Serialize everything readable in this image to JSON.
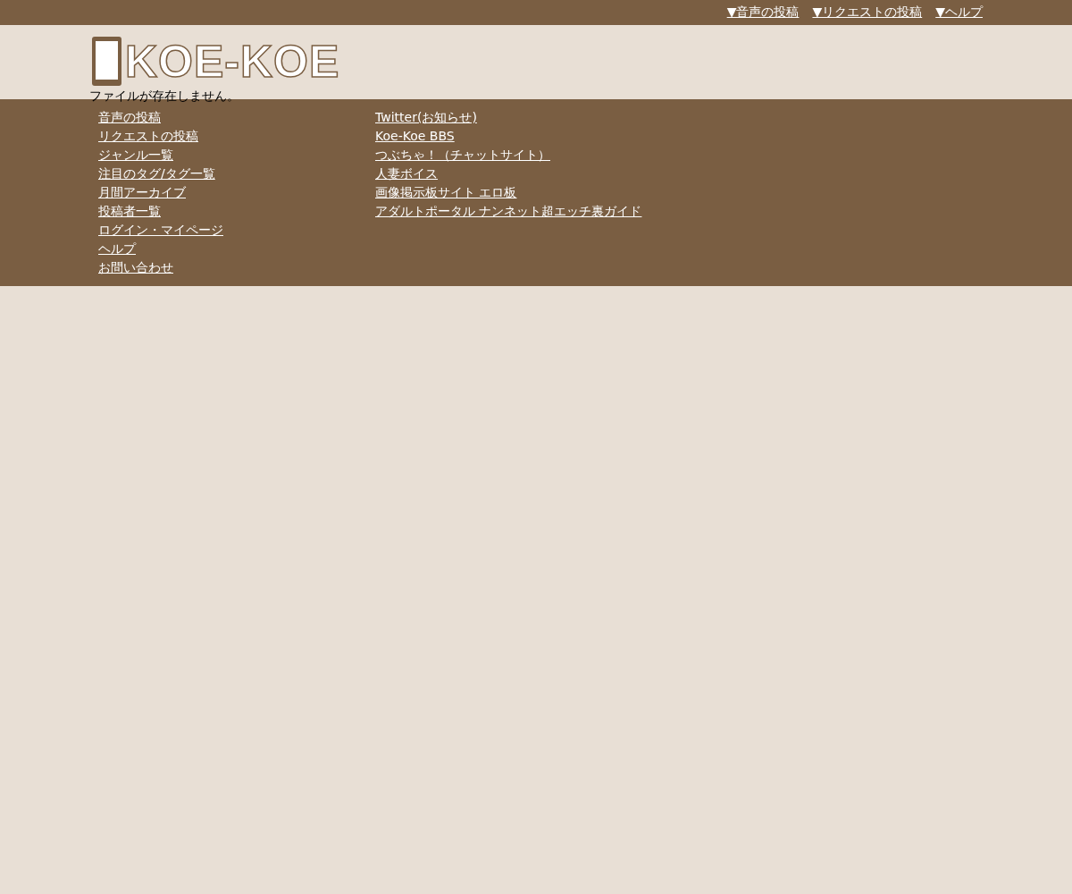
{
  "top_nav": [
    "▼音声の投稿",
    "▼リクエストの投稿",
    "▼ヘルプ"
  ],
  "logo": {
    "text": "KOE-KOE"
  },
  "message": "ファイルが存在しません。",
  "footer": {
    "column_1": [
      "音声の投稿",
      "リクエストの投稿",
      "ジャンル一覧",
      "注目のタグ/タグ一覧",
      "月間アーカイブ",
      "投稿者一覧",
      "ログイン・マイページ",
      "ヘルプ",
      "お問い合わせ"
    ],
    "column_2": [
      "Twitter(お知らせ)",
      "Koe-Koe BBS",
      "つぶちゃ！（チャットサイト）",
      "人妻ボイス",
      "画像掲示板サイト エロ板",
      "アダルトポータル ナンネット超エッチ裏ガイド"
    ]
  }
}
